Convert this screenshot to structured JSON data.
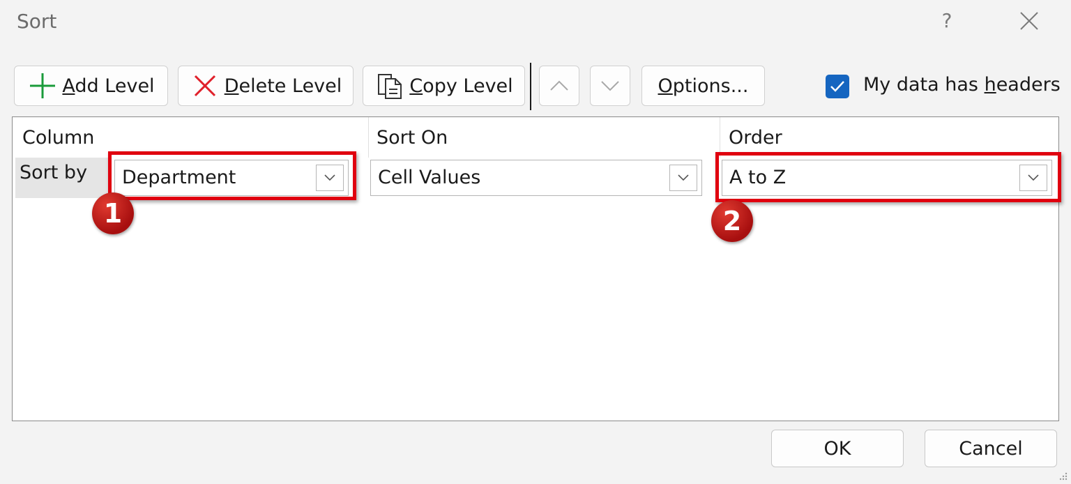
{
  "window": {
    "title": "Sort",
    "help_label": "?"
  },
  "toolbar": {
    "add_level": {
      "pre": "",
      "key": "A",
      "post": "dd Level"
    },
    "delete_level": {
      "pre": "",
      "key": "D",
      "post": "elete Level"
    },
    "copy_level": {
      "pre": "",
      "key": "C",
      "post": "opy Level"
    },
    "options": {
      "pre": "",
      "key": "O",
      "post": "ptions..."
    },
    "headers_checkbox": {
      "checked": true,
      "pre": "My data has ",
      "key": "h",
      "post": "eaders"
    }
  },
  "grid": {
    "headers": [
      "Column",
      "Sort On",
      "Order"
    ],
    "rows": [
      {
        "label": "Sort by",
        "column": "Department",
        "sort_on": "Cell Values",
        "order": "A to Z"
      }
    ]
  },
  "annotations": {
    "badge1": "1",
    "badge2": "2",
    "highlight_color": "#e0000f"
  },
  "footer": {
    "ok": "OK",
    "cancel": "Cancel"
  },
  "colors": {
    "accent": "#1565c0",
    "dialog_bg": "#f3f3f3"
  },
  "icons": [
    "plus-icon",
    "x-icon",
    "copy-icon",
    "chevron-up-icon",
    "chevron-down-icon",
    "checkmark-icon",
    "close-icon"
  ]
}
